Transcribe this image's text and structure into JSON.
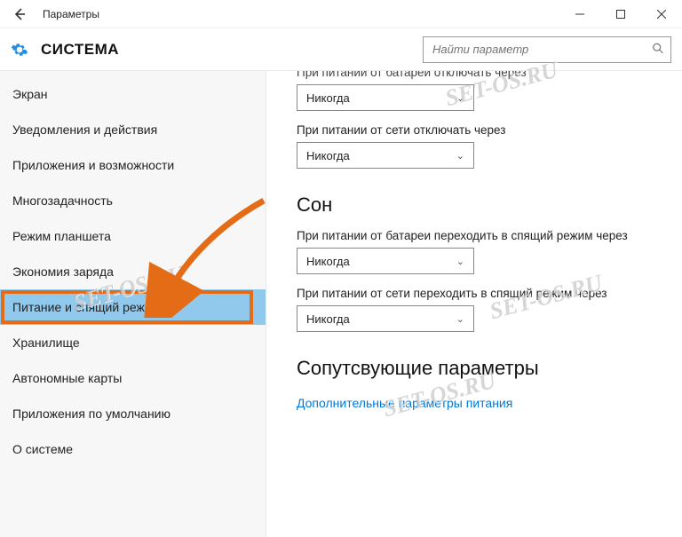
{
  "window": {
    "title": "Параметры"
  },
  "header": {
    "system_title": "СИСТЕМА",
    "search_placeholder": "Найти параметр"
  },
  "sidebar": {
    "items": [
      {
        "label": "Экран"
      },
      {
        "label": "Уведомления и действия"
      },
      {
        "label": "Приложения и возможности"
      },
      {
        "label": "Многозадачность"
      },
      {
        "label": "Режим планшета"
      },
      {
        "label": "Экономия заряда"
      },
      {
        "label": "Питание и спящий режим"
      },
      {
        "label": "Хранилище"
      },
      {
        "label": "Автономные карты"
      },
      {
        "label": "Приложения по умолчанию"
      },
      {
        "label": "О системе"
      }
    ],
    "active_index": 6
  },
  "content": {
    "battery_screen_off_label": "При питании от батареи отключать через",
    "battery_screen_off_value": "Никогда",
    "plugged_screen_off_label": "При питании от сети отключать через",
    "plugged_screen_off_value": "Никогда",
    "sleep_heading": "Сон",
    "battery_sleep_label": "При питании от батареи переходить в спящий режим через",
    "battery_sleep_value": "Никогда",
    "plugged_sleep_label": "При питании от сети переходить в спящий режим через",
    "plugged_sleep_value": "Никогда",
    "related_heading": "Сопутсвующие параметры",
    "related_link": "Дополнительные параметры питания"
  },
  "watermark_text": "SET-OS.RU"
}
